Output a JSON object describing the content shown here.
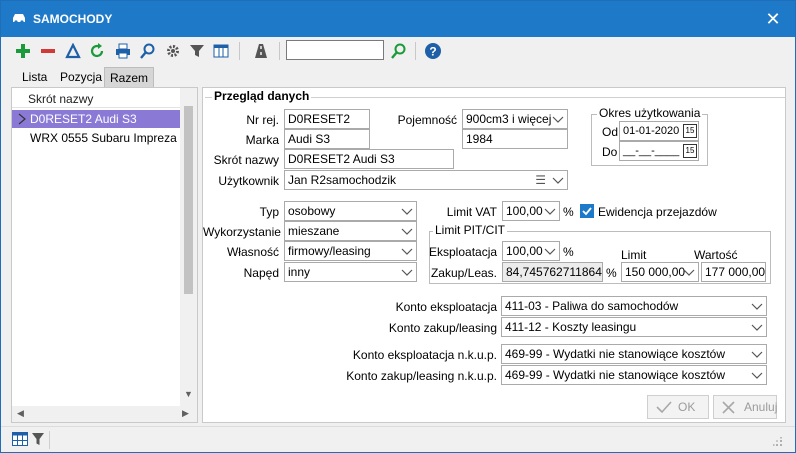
{
  "window": {
    "title": "SAMOCHODY"
  },
  "tabs": [
    {
      "label": "Lista"
    },
    {
      "label": "Pozycja"
    },
    {
      "label": "Razem"
    }
  ],
  "list": {
    "header": "Skrót nazwy",
    "rows": [
      {
        "label": "D0RESET2 Audi S3"
      },
      {
        "label": "WRX 0555 Subaru Impreza"
      }
    ]
  },
  "form": {
    "group_title": "Przegląd danych",
    "nr_rej": {
      "label": "Nr rej.",
      "value": "D0RESET2"
    },
    "marka": {
      "label": "Marka",
      "value": "Audi S3"
    },
    "pojemnosc": {
      "label": "Pojemność",
      "value": "900cm3 i więcej"
    },
    "rok": {
      "value": "1984"
    },
    "skrot": {
      "label": "Skrót nazwy",
      "value": "D0RESET2 Audi S3"
    },
    "uzytkownik": {
      "label": "Użytkownik",
      "value": "Jan R2samochodzik"
    },
    "okres": {
      "title": "Okres użytkowania",
      "od_label": "Od",
      "od_value": "01-01-2020",
      "do_label": "Do",
      "do_value": "__-__-____",
      "cal": "15"
    },
    "typ": {
      "label": "Typ",
      "value": "osobowy"
    },
    "wykorzystanie": {
      "label": "Wykorzystanie",
      "value": "mieszane"
    },
    "wlasnosc": {
      "label": "Własność",
      "value": "firmowy/leasing"
    },
    "naped": {
      "label": "Napęd",
      "value": "inny"
    },
    "limit_vat": {
      "label": "Limit VAT",
      "value": "100,00",
      "unit": "%"
    },
    "ewidencja": {
      "label": "Ewidencja przejazdów",
      "checked": true
    },
    "pit": {
      "title": "Limit PIT/CIT",
      "eksploatacja_label": "Eksploatacja",
      "eksploatacja_value": "100,00",
      "unit": "%",
      "zakup_label": "Zakup/Leas.",
      "zakup_value": "84,7457627118644",
      "limit_header": "Limit",
      "limit_value": "150 000,00",
      "wartosc_header": "Wartość",
      "wartosc_value": "177 000,00"
    },
    "konto_eksp": {
      "label": "Konto eksploatacja",
      "value": "411-03 - Paliwa do samochodów"
    },
    "konto_zakup": {
      "label": "Konto zakup/leasing",
      "value": "411-12 - Koszty leasingu"
    },
    "konto_eksp_nkup": {
      "label": "Konto eksploatacja n.k.u.p.",
      "value": "469-99 - Wydatki nie stanowiące kosztów"
    },
    "konto_zakup_nkup": {
      "label": "Konto zakup/leasing n.k.u.p.",
      "value": "469-99 - Wydatki nie stanowiące kosztów"
    }
  },
  "buttons": {
    "ok": "OK",
    "anuluj": "Anuluj"
  },
  "colors": {
    "titlebar": "#1e79c8",
    "selection": "#8a7ad6",
    "accent_green": "#1a9a3b",
    "accent_red": "#d23a3a"
  }
}
